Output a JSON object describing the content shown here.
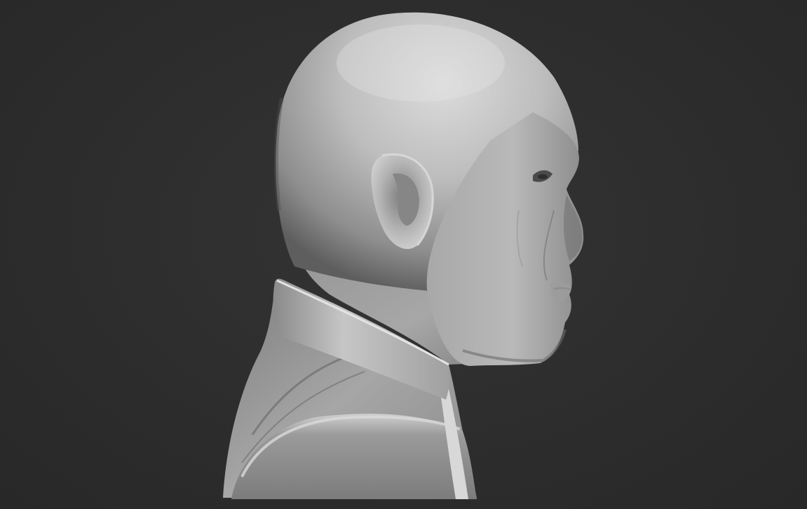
{
  "scene": {
    "background_color": "#2c2c2c",
    "material_color": "#b5b5b5",
    "subject": "bust-sculpt-profile",
    "view": "right-side-profile"
  }
}
